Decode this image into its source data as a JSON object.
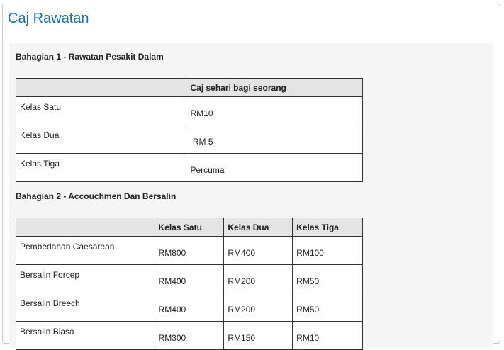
{
  "page": {
    "title": "Caj Rawatan"
  },
  "section1": {
    "title": "Bahagian 1 - Rawatan Pesakit Dalam",
    "headers": [
      "",
      "Caj sehari bagi seorang"
    ],
    "rows": [
      {
        "label": "Kelas Satu",
        "value": "RM10"
      },
      {
        "label": "Kelas Dua",
        "value": " RM 5"
      },
      {
        "label": "Kelas Tiga",
        "value": "Percuma"
      }
    ]
  },
  "section2": {
    "title": "Bahagian 2 - Accouchmen Dan Bersalin",
    "headers": [
      "",
      "Kelas Satu",
      "Kelas Dua",
      "Kelas Tiga"
    ],
    "rows": [
      {
        "label": "Pembedahan Caesarean",
        "values": [
          "RM800",
          "RM400",
          "RM100"
        ]
      },
      {
        "label": "Bersalin Forcep",
        "values": [
          "RM400",
          "RM200",
          "RM50"
        ]
      },
      {
        "label": "Bersalin Breech",
        "values": [
          "RM400",
          "RM200",
          "RM50"
        ]
      },
      {
        "label": "Bersalin Biasa",
        "values": [
          "RM300",
          "RM150",
          "RM10"
        ]
      }
    ]
  }
}
